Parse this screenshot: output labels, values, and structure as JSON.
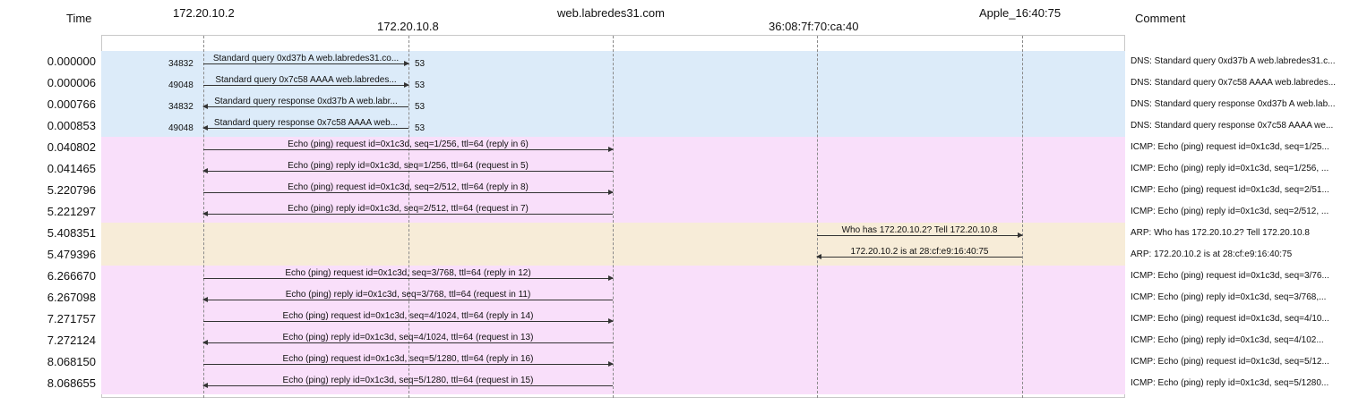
{
  "headers": {
    "time": "Time",
    "comment": "Comment",
    "hosts": [
      "172.20.10.2",
      "172.20.10.8",
      "web.labredes31.com",
      "36:08:7f:70:ca:40",
      "Apple_16:40:75"
    ]
  },
  "colors": {
    "dns": "#dcebf9",
    "icmp": "#f9dffa",
    "arp": "#f7ecd8",
    "line": "#333333"
  },
  "rows": [
    {
      "time": "0.000000",
      "proto": "dns",
      "from": 0,
      "to": 1,
      "src_port": "34832",
      "dst_port": "53",
      "label": "Standard query 0xd37b A web.labredes31.co...",
      "comment": "DNS: Standard query 0xd37b A web.labredes31.c..."
    },
    {
      "time": "0.000006",
      "proto": "dns",
      "from": 0,
      "to": 1,
      "src_port": "49048",
      "dst_port": "53",
      "label": "Standard query 0x7c58 AAAA web.labredes...",
      "comment": "DNS: Standard query 0x7c58 AAAA web.labredes..."
    },
    {
      "time": "0.000766",
      "proto": "dns",
      "from": 1,
      "to": 0,
      "src_port": "34832",
      "dst_port": "53",
      "label": "Standard query response 0xd37b A web.labr...",
      "comment": "DNS: Standard query response 0xd37b A web.lab..."
    },
    {
      "time": "0.000853",
      "proto": "dns",
      "from": 1,
      "to": 0,
      "src_port": "49048",
      "dst_port": "53",
      "label": "Standard query response 0x7c58 AAAA web...",
      "comment": "DNS: Standard query response 0x7c58 AAAA we..."
    },
    {
      "time": "0.040802",
      "proto": "icmp",
      "from": 0,
      "to": 2,
      "label": "Echo (ping) request  id=0x1c3d, seq=1/256, ttl=64 (reply in 6)",
      "comment": "ICMP: Echo (ping) request  id=0x1c3d, seq=1/25..."
    },
    {
      "time": "0.041465",
      "proto": "icmp",
      "from": 2,
      "to": 0,
      "label": "Echo (ping) reply    id=0x1c3d, seq=1/256, ttl=64 (request in 5)",
      "comment": "ICMP: Echo (ping) reply    id=0x1c3d, seq=1/256, ..."
    },
    {
      "time": "5.220796",
      "proto": "icmp",
      "from": 0,
      "to": 2,
      "label": "Echo (ping) request  id=0x1c3d, seq=2/512, ttl=64 (reply in 8)",
      "comment": "ICMP: Echo (ping) request  id=0x1c3d, seq=2/51..."
    },
    {
      "time": "5.221297",
      "proto": "icmp",
      "from": 2,
      "to": 0,
      "label": "Echo (ping) reply    id=0x1c3d, seq=2/512, ttl=64 (request in 7)",
      "comment": "ICMP: Echo (ping) reply    id=0x1c3d, seq=2/512, ..."
    },
    {
      "time": "5.408351",
      "proto": "arp",
      "from": 3,
      "to": 4,
      "label": "Who has 172.20.10.2? Tell 172.20.10.8",
      "comment": "ARP: Who has 172.20.10.2? Tell 172.20.10.8"
    },
    {
      "time": "5.479396",
      "proto": "arp",
      "from": 4,
      "to": 3,
      "label": "172.20.10.2 is at 28:cf:e9:16:40:75",
      "comment": "ARP: 172.20.10.2 is at 28:cf:e9:16:40:75"
    },
    {
      "time": "6.266670",
      "proto": "icmp",
      "from": 0,
      "to": 2,
      "label": "Echo (ping) request  id=0x1c3d, seq=3/768, ttl=64 (reply in 12)",
      "comment": "ICMP: Echo (ping) request  id=0x1c3d, seq=3/76..."
    },
    {
      "time": "6.267098",
      "proto": "icmp",
      "from": 2,
      "to": 0,
      "label": "Echo (ping) reply    id=0x1c3d, seq=3/768, ttl=64 (request in 11)",
      "comment": "ICMP: Echo (ping) reply    id=0x1c3d, seq=3/768,..."
    },
    {
      "time": "7.271757",
      "proto": "icmp",
      "from": 0,
      "to": 2,
      "label": "Echo (ping) request  id=0x1c3d, seq=4/1024, ttl=64 (reply in 14)",
      "comment": "ICMP: Echo (ping) request  id=0x1c3d, seq=4/10..."
    },
    {
      "time": "7.272124",
      "proto": "icmp",
      "from": 2,
      "to": 0,
      "label": "Echo (ping) reply    id=0x1c3d, seq=4/1024, ttl=64 (request in 13)",
      "comment": "ICMP: Echo (ping) reply    id=0x1c3d, seq=4/102..."
    },
    {
      "time": "8.068150",
      "proto": "icmp",
      "from": 0,
      "to": 2,
      "label": "Echo (ping) request  id=0x1c3d, seq=5/1280, ttl=64 (reply in 16)",
      "comment": "ICMP: Echo (ping) request  id=0x1c3d, seq=5/12..."
    },
    {
      "time": "8.068655",
      "proto": "icmp",
      "from": 2,
      "to": 0,
      "label": "Echo (ping) reply    id=0x1c3d, seq=5/1280, ttl=64 (request in 15)",
      "comment": "ICMP: Echo (ping) reply    id=0x1c3d, seq=5/1280..."
    }
  ]
}
